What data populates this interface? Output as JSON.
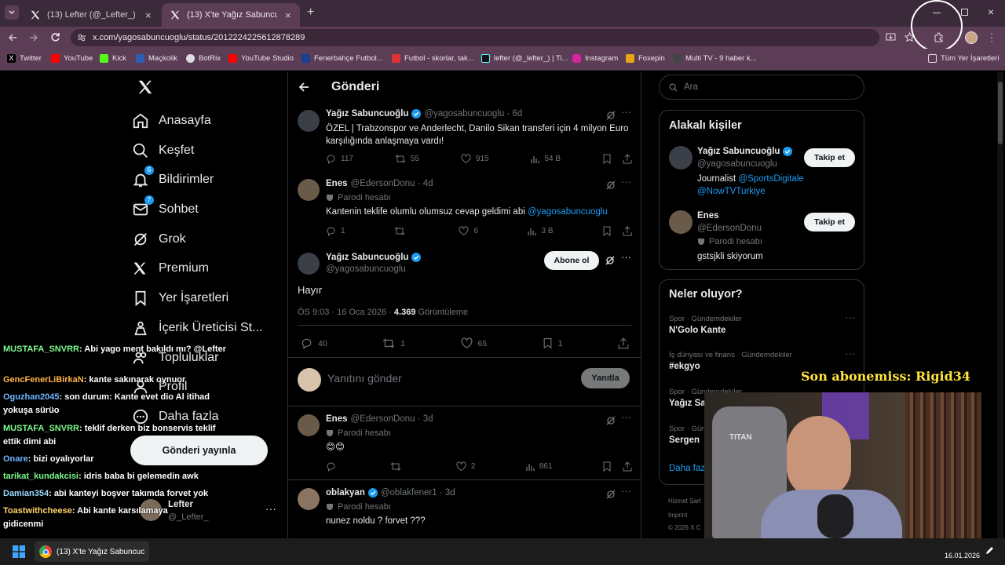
{
  "browser": {
    "tabs": [
      {
        "label": "(13) Lefter (@_Lefter_) / X",
        "close": "×"
      },
      {
        "label": "(13) X'te Yağız Sabuncuoğlu: \"Ö",
        "close": "×"
      }
    ],
    "new_tab": "+",
    "url": "x.com/yagosabuncuoglu/status/2012224225612878289",
    "bookmarks": [
      {
        "label": "Twitter",
        "color": "#ffffff"
      },
      {
        "label": "YouTube",
        "color": "#ff0000"
      },
      {
        "label": "Kick",
        "color": "#53fc18"
      },
      {
        "label": "Maçkolik",
        "color": "#2b5fb5"
      },
      {
        "label": "BotRix",
        "color": "#dddddd"
      },
      {
        "label": "YouTube Studio",
        "color": "#ff0000"
      },
      {
        "label": "Fenerbahçe Futbol...",
        "color": "#1c3e8f"
      },
      {
        "label": "Futbol - skorlar, tak...",
        "color": "#d33"
      },
      {
        "label": "lefter (@_lefter_) | Ti...",
        "color": "#111"
      },
      {
        "label": "Instagram",
        "color": "#d6249f"
      },
      {
        "label": "Foxepin",
        "color": "#e8a317"
      },
      {
        "label": "Multi TV - 9 haber k...",
        "color": "#444"
      }
    ],
    "all_bookmarks": "Tüm Yer İşaretleri"
  },
  "sidebar": {
    "items": [
      {
        "label": "Anasayfa",
        "icon": "home-icon"
      },
      {
        "label": "Keşfet",
        "icon": "search-icon"
      },
      {
        "label": "Bildirimler",
        "icon": "bell-icon",
        "badge": "6"
      },
      {
        "label": "Sohbet",
        "icon": "mail-icon",
        "badge": "7"
      },
      {
        "label": "Grok",
        "icon": "grok-icon"
      },
      {
        "label": "Premium",
        "icon": "x-logo-icon"
      },
      {
        "label": "Yer İşaretleri",
        "icon": "bookmark-icon"
      },
      {
        "label": "İçerik Üreticisi St...",
        "icon": "creator-icon"
      },
      {
        "label": "Topluluklar",
        "icon": "people-icon"
      },
      {
        "label": "Profil",
        "icon": "person-icon"
      },
      {
        "label": "Daha fazla",
        "icon": "more-circle-icon"
      }
    ],
    "post_button": "Gönderi yayınla",
    "account": {
      "name": "Lefter",
      "handle": "@_Lefter_"
    }
  },
  "main": {
    "title": "Gönderi",
    "parent": {
      "name": "Yağız Sabuncuoğlu",
      "handle": "@yagosabuncuoglu · 6d",
      "text": "ÖZEL | Trabzonspor ve Anderlecht, Danilo Sikan transferi için 4 milyon Euro karşılığında anlaşmaya vardı!",
      "replies": "117",
      "reposts": "55",
      "likes": "915",
      "views": "54 B"
    },
    "reply1": {
      "name": "Enes",
      "handle": "@EdersonDonu · 4d",
      "parody": "Parodi hesabı",
      "text": "Kantenin teklife olumlu olumsuz cevap geldimi abi",
      "mention": "@yagosabuncuoglu",
      "replies": "1",
      "reposts": "",
      "likes": "6",
      "views": "3 B"
    },
    "focus": {
      "name": "Yağız Sabuncuoğlu",
      "handle": "@yagosabuncuoglu",
      "subscribe": "Abone ol",
      "text": "Hayır",
      "time": "ÖS 9:03 · 16 Oca 2026 ·",
      "views_count": "4.369",
      "views_label": "Görüntüleme",
      "replies": "40",
      "reposts": "1",
      "likes": "65",
      "bookmarks": "1"
    },
    "compose": {
      "placeholder": "Yanıtını gönder",
      "button": "Yanıtla"
    },
    "reply2": {
      "name": "Enes",
      "handle": "@EdersonDonu · 3d",
      "parody": "Parodi hesabı",
      "text": "😊😊",
      "replies": "",
      "reposts": "",
      "likes": "2",
      "views": "861"
    },
    "reply3": {
      "name": "oblakyan",
      "handle": "@oblakfener1 · 3d",
      "parody": "Parodi hesabı",
      "text": "nunez noldu ? forvet ???"
    }
  },
  "right": {
    "search_placeholder": "Ara",
    "related_title": "Alakalı kişiler",
    "people": [
      {
        "name": "Yağız Sabuncuoğlu",
        "handle": "@yagosabuncuoglu",
        "bio_prefix": "Journalist ",
        "bio_link1": "@SportsDigitale",
        "bio_link2": "@NowTVTurkiye",
        "button": "Takip et"
      },
      {
        "name": "Enes",
        "handle": "@EdersonDonu",
        "parody": "Parodi hesabı",
        "bio": "gstsjkli skiyorum",
        "button": "Takip et"
      }
    ],
    "trends_title": "Neler oluyor?",
    "trends": [
      {
        "category": "Spor · Gündemdekiler",
        "topic": "N'Golo Kante"
      },
      {
        "category": "İş dünyası ve finans · Gündemdekiler",
        "topic": "#ekgyo"
      },
      {
        "category": "Spor · Gündemdekiler",
        "topic": "Yağız Sa"
      },
      {
        "category": "Spor · Gündemdekiler",
        "topic": "Sergen"
      }
    ],
    "show_more": "Daha faz",
    "footer1": "Hizmet Şart",
    "footer2": "İmprint",
    "footer3": "© 2026 X C"
  },
  "overlay": {
    "subscriber": "Son abonemiss: Rigid34",
    "chair_brand": "TITAN",
    "chat": [
      {
        "user": "MUSTAFA_SNVRR",
        "color": "#7cfc8a",
        "msg": ": Abi yago ment bakıldı mı? @Lefter"
      },
      {
        "user": "GencFenerLiBirkaN",
        "color": "#ffb347",
        "msg": ": kante sakınarak oynuor"
      },
      {
        "user": "Oguzhan2045",
        "color": "#6fb7ff",
        "msg": ": son durum: Kante evet dio Al itihad yokuşa sürüo"
      },
      {
        "user": "MUSTAFA_SNVRR",
        "color": "#7cfc8a",
        "msg": ": teklif derken biz bonservis teklif ettik dimi abi"
      },
      {
        "user": "Onare",
        "color": "#6fb7ff",
        "msg": ": bizi oyalıyorlar"
      },
      {
        "user": "tarikat_kundakcisi",
        "color": "#7cfc8a",
        "msg": ": idris baba bi gelemedin awk"
      },
      {
        "user": "Damian354",
        "color": "#a0d8ff",
        "msg": ": abi kanteyi boşver takımda forvet yok"
      },
      {
        "user": "Toastwithcheese",
        "color": "#ffd36b",
        "msg": ": Abi kante karsılamaya gidicenmi"
      }
    ]
  },
  "taskbar": {
    "app_label": "(13) X'te Yağız Sabuncuc",
    "date": "16.01.2026"
  }
}
